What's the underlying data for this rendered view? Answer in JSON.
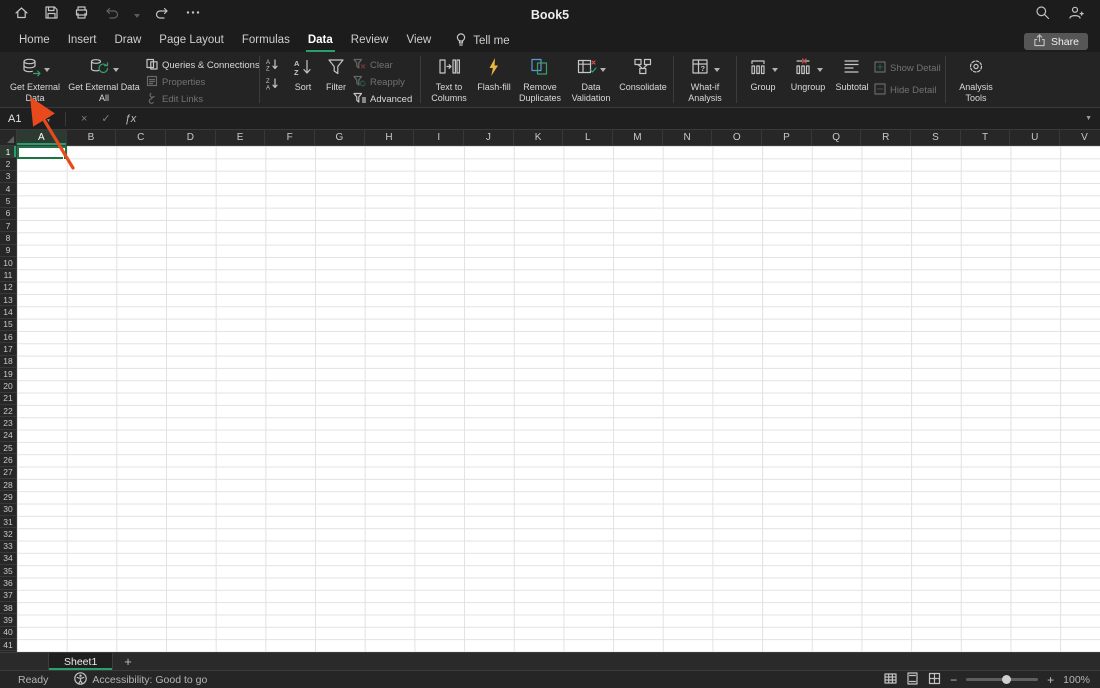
{
  "colors": {
    "accent_green": "#27a06d",
    "selection_green": "#1f7244",
    "arrow_red": "#e8491d"
  },
  "icons": {
    "undo": "↺",
    "redo": "↻",
    "more": "⋯",
    "spinner_up": "▲",
    "spinner_down": "▼",
    "cancel": "×",
    "enter": "✓",
    "fx": "ƒx",
    "formula_dropdown": "▼",
    "zoom_out": "−",
    "zoom_in": "+"
  },
  "titlebar": {
    "title": "Book5"
  },
  "tabs": {
    "items": [
      {
        "label": "Home"
      },
      {
        "label": "Insert"
      },
      {
        "label": "Draw"
      },
      {
        "label": "Page Layout"
      },
      {
        "label": "Formulas"
      },
      {
        "label": "Data",
        "active": true
      },
      {
        "label": "Review"
      },
      {
        "label": "View"
      }
    ],
    "tell_me": "Tell me",
    "share": "Share"
  },
  "ribbon": {
    "get_external_data": {
      "line1": "Get External",
      "line2": "Data"
    },
    "refresh_all": {
      "line1": "Get External Data",
      "line2": "All"
    },
    "queries_connections": "Queries & Connections",
    "properties": "Properties",
    "edit_links": "Edit Links",
    "sort": "Sort",
    "filter": "Filter",
    "clear": "Clear",
    "reapply": "Reapply",
    "advanced": "Advanced",
    "text_to_columns": {
      "line1": "Text to",
      "line2": "Columns"
    },
    "flash_fill": "Flash-fill",
    "remove_duplicates": {
      "line1": "Remove",
      "line2": "Duplicates"
    },
    "data_validation": {
      "line1": "Data",
      "line2": "Validation"
    },
    "consolidate": "Consolidate",
    "what_if_analysis": {
      "line1": "What-if",
      "line2": "Analysis"
    },
    "group": "Group",
    "ungroup": "Ungroup",
    "subtotal": "Subtotal",
    "show_detail": "Show Detail",
    "hide_detail": "Hide Detail",
    "analysis_tools": {
      "line1": "Analysis",
      "line2": "Tools"
    }
  },
  "formula_bar": {
    "name_box": "A1"
  },
  "grid": {
    "columns": [
      "A",
      "B",
      "C",
      "D",
      "E",
      "F",
      "G",
      "H",
      "I",
      "J",
      "K",
      "L",
      "M",
      "N",
      "O",
      "P",
      "Q",
      "R",
      "S",
      "T",
      "U",
      "V"
    ],
    "row_count": 41,
    "selected_cell": "A1"
  },
  "sheet_tabs": {
    "tabs": [
      {
        "label": "Sheet1",
        "active": true
      }
    ],
    "add_label": "+"
  },
  "status_bar": {
    "ready": "Ready",
    "accessibility": "Accessibility: Good to go",
    "zoom_level": "100%"
  }
}
